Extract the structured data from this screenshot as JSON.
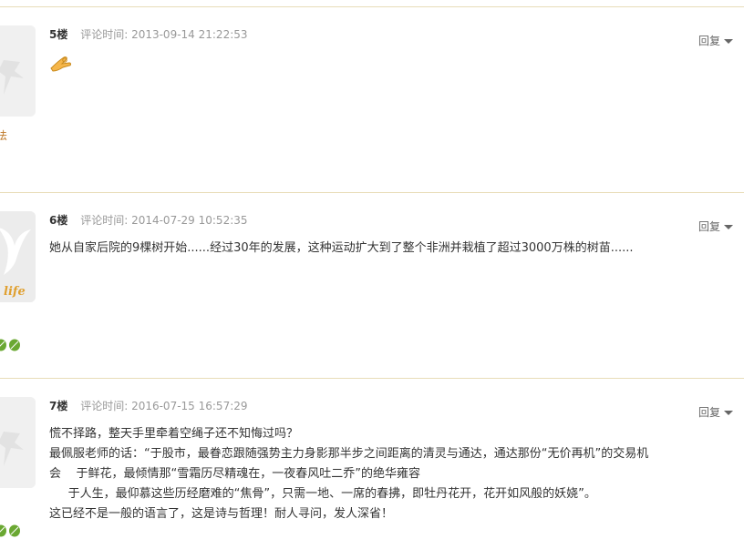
{
  "posts": [
    {
      "floor": "5楼",
      "time_label": "评论时间:",
      "time": "2013-09-14 21:22:53",
      "reply_label": "回复",
      "side_text": "法",
      "content": [],
      "emoji": "ok-hand-emoji"
    },
    {
      "floor": "6楼",
      "time_label": "评论时间:",
      "time": "2014-07-29 10:52:35",
      "reply_label": "回复",
      "avatar_text": "life",
      "content": [
        "她从自家后院的9棵树开始......经过30年的发展，这种运动扩大到了整个非洲并栽植了超过3000万株的树苗......"
      ]
    },
    {
      "floor": "7楼",
      "time_label": "评论时间:",
      "time": "2016-07-15 16:57:29",
      "reply_label": "回复",
      "content": [
        "慌不择路，整天手里牵着空绳子还不知悔过吗？",
        "最佩服老师的话：“于股市，最眷恋跟随强势主力身影那半步之间距离的清灵与通达，通达那份“无价再机”的交易机",
        "会    于鲜花，最倾情那“雪霜历尽精魂在，一夜春风吐二乔”的绝华雍容",
        "     于人生，最仰慕这些历经磨难的“焦骨”，只需一地、一席的春拂，即牡丹花开，花开如风般的妖娆”。",
        "这已经不是一般的语言了，这是诗与哲理！耐人寻问，发人深省！"
      ]
    }
  ],
  "colors": {
    "divider": "#e8dcb8",
    "side_text": "#c07a2a",
    "leaf": "#6aa832"
  }
}
